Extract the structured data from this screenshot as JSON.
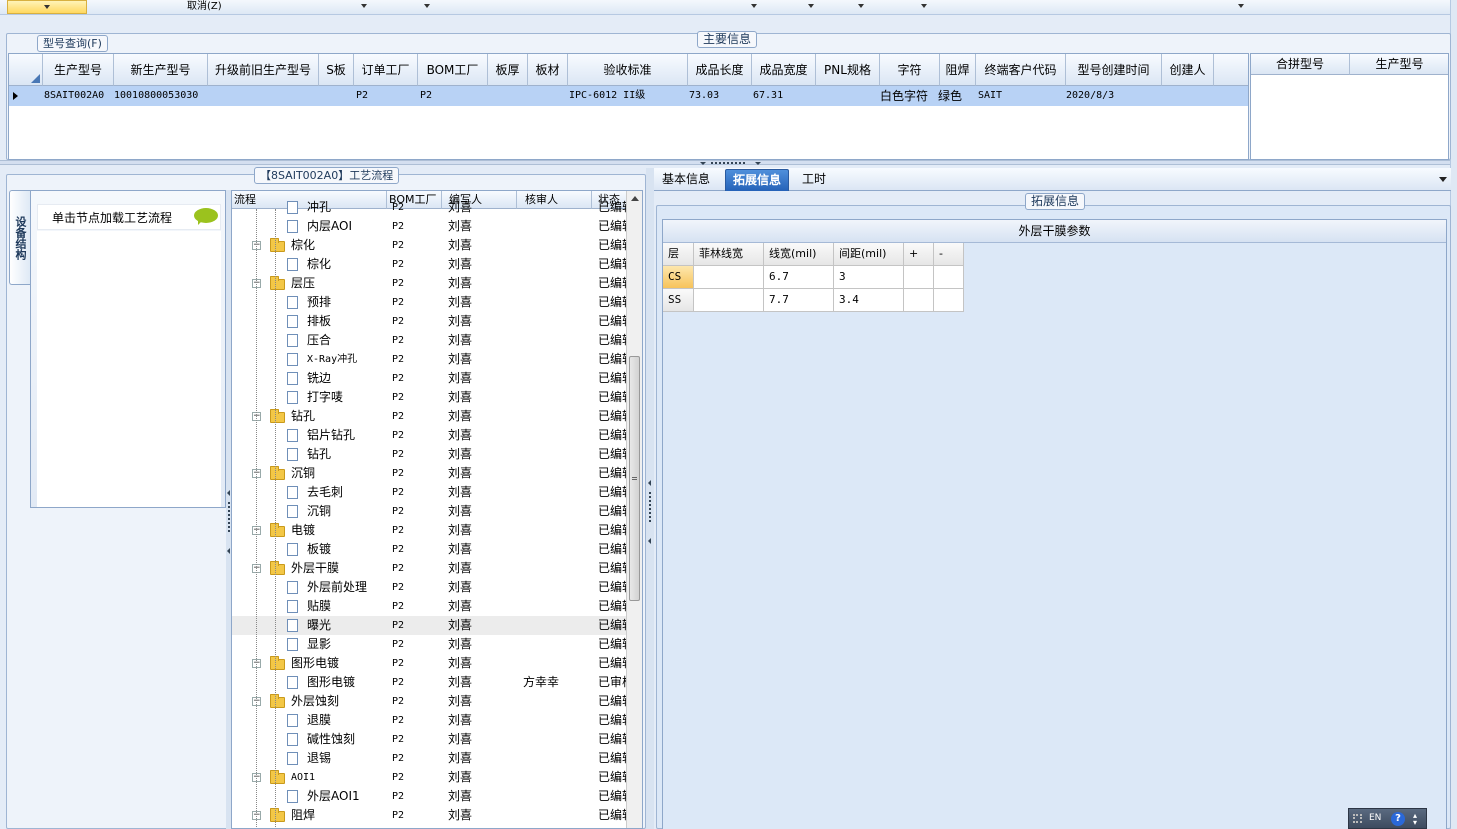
{
  "toolbar": {
    "cancel_label": "取消(Z)"
  },
  "model_search": {
    "legend": "型号查询(F)"
  },
  "main_info": {
    "legend": "主要信息",
    "columns": [
      "生产型号",
      "新生产型号",
      "升级前旧生产型号",
      "S板",
      "订单工厂",
      "BOM工厂",
      "板厚",
      "板材",
      "验收标准",
      "成品长度",
      "成品宽度",
      "PNL规格",
      "字符",
      "阻焊",
      "终端客户代码",
      "型号创建时间",
      "创建人"
    ],
    "row": {
      "prod_model": "8SAIT002A0",
      "new_prod_model": "10010800053030",
      "old_model": "",
      "s_board": "",
      "order_factory": "P2",
      "bom_factory": "P2",
      "thickness": "",
      "material": "",
      "standard": "IPC-6012 II级",
      "length": "73.03",
      "width": "67.31",
      "pnl": "",
      "character": "白色字符",
      "solder_mask": "绿色",
      "customer": "SAIT",
      "created": "2020/8/3",
      "creator": ""
    }
  },
  "merge_panel": {
    "columns": [
      "合拼型号",
      "生产型号"
    ]
  },
  "process": {
    "legend": "【8SAIT002A0】工艺流程",
    "side_tab": "设备结构",
    "load_hint": "单击节点加载工艺流程",
    "columns": [
      "流程",
      "BOM工厂",
      "编写人",
      "核审人",
      "状态"
    ],
    "rows": [
      {
        "level": 2,
        "name": "冲孔",
        "bom": "P2",
        "writer": "刘喜",
        "reviewer": "",
        "status": "已编辑"
      },
      {
        "level": 2,
        "name": "内层AOI",
        "bom": "P2",
        "writer": "刘喜",
        "reviewer": "",
        "status": "已编辑"
      },
      {
        "level": 1,
        "name": "棕化",
        "bom": "P2",
        "writer": "刘喜",
        "reviewer": "",
        "status": "已编辑"
      },
      {
        "level": 2,
        "name": "棕化",
        "bom": "P2",
        "writer": "刘喜",
        "reviewer": "",
        "status": "已编辑"
      },
      {
        "level": 1,
        "name": "层压",
        "bom": "P2",
        "writer": "刘喜",
        "reviewer": "",
        "status": "已编辑"
      },
      {
        "level": 2,
        "name": "预排",
        "bom": "P2",
        "writer": "刘喜",
        "reviewer": "",
        "status": "已编辑"
      },
      {
        "level": 2,
        "name": "排板",
        "bom": "P2",
        "writer": "刘喜",
        "reviewer": "",
        "status": "已编辑"
      },
      {
        "level": 2,
        "name": "压合",
        "bom": "P2",
        "writer": "刘喜",
        "reviewer": "",
        "status": "已编辑"
      },
      {
        "level": 2,
        "name": "X-Ray冲孔",
        "bom": "P2",
        "writer": "刘喜",
        "reviewer": "",
        "status": "已编辑"
      },
      {
        "level": 2,
        "name": "铣边",
        "bom": "P2",
        "writer": "刘喜",
        "reviewer": "",
        "status": "已编辑"
      },
      {
        "level": 2,
        "name": "打字唛",
        "bom": "P2",
        "writer": "刘喜",
        "reviewer": "",
        "status": "已编辑"
      },
      {
        "level": 1,
        "name": "钻孔",
        "bom": "P2",
        "writer": "刘喜",
        "reviewer": "",
        "status": "已编辑"
      },
      {
        "level": 2,
        "name": "铝片钻孔",
        "bom": "P2",
        "writer": "刘喜",
        "reviewer": "",
        "status": "已编辑"
      },
      {
        "level": 2,
        "name": "钻孔",
        "bom": "P2",
        "writer": "刘喜",
        "reviewer": "",
        "status": "已编辑"
      },
      {
        "level": 1,
        "name": "沉铜",
        "bom": "P2",
        "writer": "刘喜",
        "reviewer": "",
        "status": "已编辑"
      },
      {
        "level": 2,
        "name": "去毛刺",
        "bom": "P2",
        "writer": "刘喜",
        "reviewer": "",
        "status": "已编辑"
      },
      {
        "level": 2,
        "name": "沉铜",
        "bom": "P2",
        "writer": "刘喜",
        "reviewer": "",
        "status": "已编辑"
      },
      {
        "level": 1,
        "name": "电镀",
        "bom": "P2",
        "writer": "刘喜",
        "reviewer": "",
        "status": "已编辑"
      },
      {
        "level": 2,
        "name": "板镀",
        "bom": "P2",
        "writer": "刘喜",
        "reviewer": "",
        "status": "已编辑"
      },
      {
        "level": 1,
        "name": "外层干膜",
        "bom": "P2",
        "writer": "刘喜",
        "reviewer": "",
        "status": "已编辑"
      },
      {
        "level": 2,
        "name": "外层前处理",
        "bom": "P2",
        "writer": "刘喜",
        "reviewer": "",
        "status": "已编辑"
      },
      {
        "level": 2,
        "name": "贴膜",
        "bom": "P2",
        "writer": "刘喜",
        "reviewer": "",
        "status": "已编辑"
      },
      {
        "level": 2,
        "name": "曝光",
        "bom": "P2",
        "writer": "刘喜",
        "reviewer": "",
        "status": "已编辑",
        "selected": true
      },
      {
        "level": 2,
        "name": "显影",
        "bom": "P2",
        "writer": "刘喜",
        "reviewer": "",
        "status": "已编辑"
      },
      {
        "level": 1,
        "name": "图形电镀",
        "bom": "P2",
        "writer": "刘喜",
        "reviewer": "",
        "status": "已编辑"
      },
      {
        "level": 2,
        "name": "图形电镀",
        "bom": "P2",
        "writer": "刘喜",
        "reviewer": "方幸幸",
        "status": "已审核"
      },
      {
        "level": 1,
        "name": "外层蚀刻",
        "bom": "P2",
        "writer": "刘喜",
        "reviewer": "",
        "status": "已编辑"
      },
      {
        "level": 2,
        "name": "退膜",
        "bom": "P2",
        "writer": "刘喜",
        "reviewer": "",
        "status": "已编辑"
      },
      {
        "level": 2,
        "name": "碱性蚀刻",
        "bom": "P2",
        "writer": "刘喜",
        "reviewer": "",
        "status": "已编辑"
      },
      {
        "level": 2,
        "name": "退锡",
        "bom": "P2",
        "writer": "刘喜",
        "reviewer": "",
        "status": "已编辑"
      },
      {
        "level": 1,
        "name": "AOI1",
        "bom": "P2",
        "writer": "刘喜",
        "reviewer": "",
        "status": "已编辑"
      },
      {
        "level": 2,
        "name": "外层AOI1",
        "bom": "P2",
        "writer": "刘喜",
        "reviewer": "",
        "status": "已编辑"
      },
      {
        "level": 1,
        "name": "阻焊",
        "bom": "P2",
        "writer": "刘喜",
        "reviewer": "",
        "status": "已编辑"
      }
    ]
  },
  "tabs": [
    "基本信息",
    "拓展信息",
    "工时"
  ],
  "active_tab": 1,
  "ext": {
    "legend": "拓展信息",
    "title": "外层干膜参数",
    "columns": [
      "层",
      "菲林线宽",
      "线宽(mil)",
      "间距(mil)",
      "+",
      "-"
    ],
    "rows": [
      {
        "layer": "CS",
        "film": "",
        "width": "6.7",
        "space": "3"
      },
      {
        "layer": "SS",
        "film": "",
        "width": "7.7",
        "space": "3.4"
      }
    ]
  },
  "status_bar": {
    "lang": "EN",
    "help": "?"
  }
}
